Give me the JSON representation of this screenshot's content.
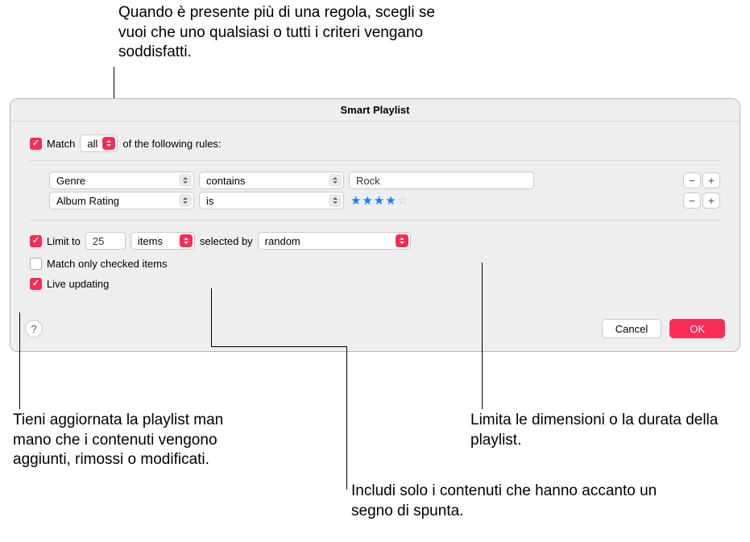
{
  "annotations": {
    "top": "Quando è presente più di una regola, scegli se vuoi che uno qualsiasi o tutti i criteri vengano soddisfatti.",
    "bottom_left": "Tieni aggiornata la playlist man mano che i contenuti vengono aggiunti, rimossi o modificati.",
    "bottom_mid": "Includi solo i contenuti che hanno accanto un segno di spunta.",
    "bottom_right": "Limita le dimensioni o la durata della playlist."
  },
  "dialog": {
    "title": "Smart Playlist",
    "match": {
      "label_prefix": "Match",
      "mode": "all",
      "label_suffix": "of the following rules:"
    },
    "rules": [
      {
        "field": "Genre",
        "operator": "contains",
        "value": "Rock",
        "value_type": "text"
      },
      {
        "field": "Album Rating",
        "operator": "is",
        "value": 4,
        "value_type": "stars",
        "stars_max": 5
      }
    ],
    "limit": {
      "label": "Limit to",
      "count": "25",
      "unit": "items",
      "selected_by_label": "selected by",
      "selected_by": "random"
    },
    "match_only_checked": {
      "label": "Match only checked items",
      "checked": false
    },
    "live_updating": {
      "label": "Live updating",
      "checked": true
    },
    "buttons": {
      "help": "?",
      "cancel": "Cancel",
      "ok": "OK"
    }
  }
}
